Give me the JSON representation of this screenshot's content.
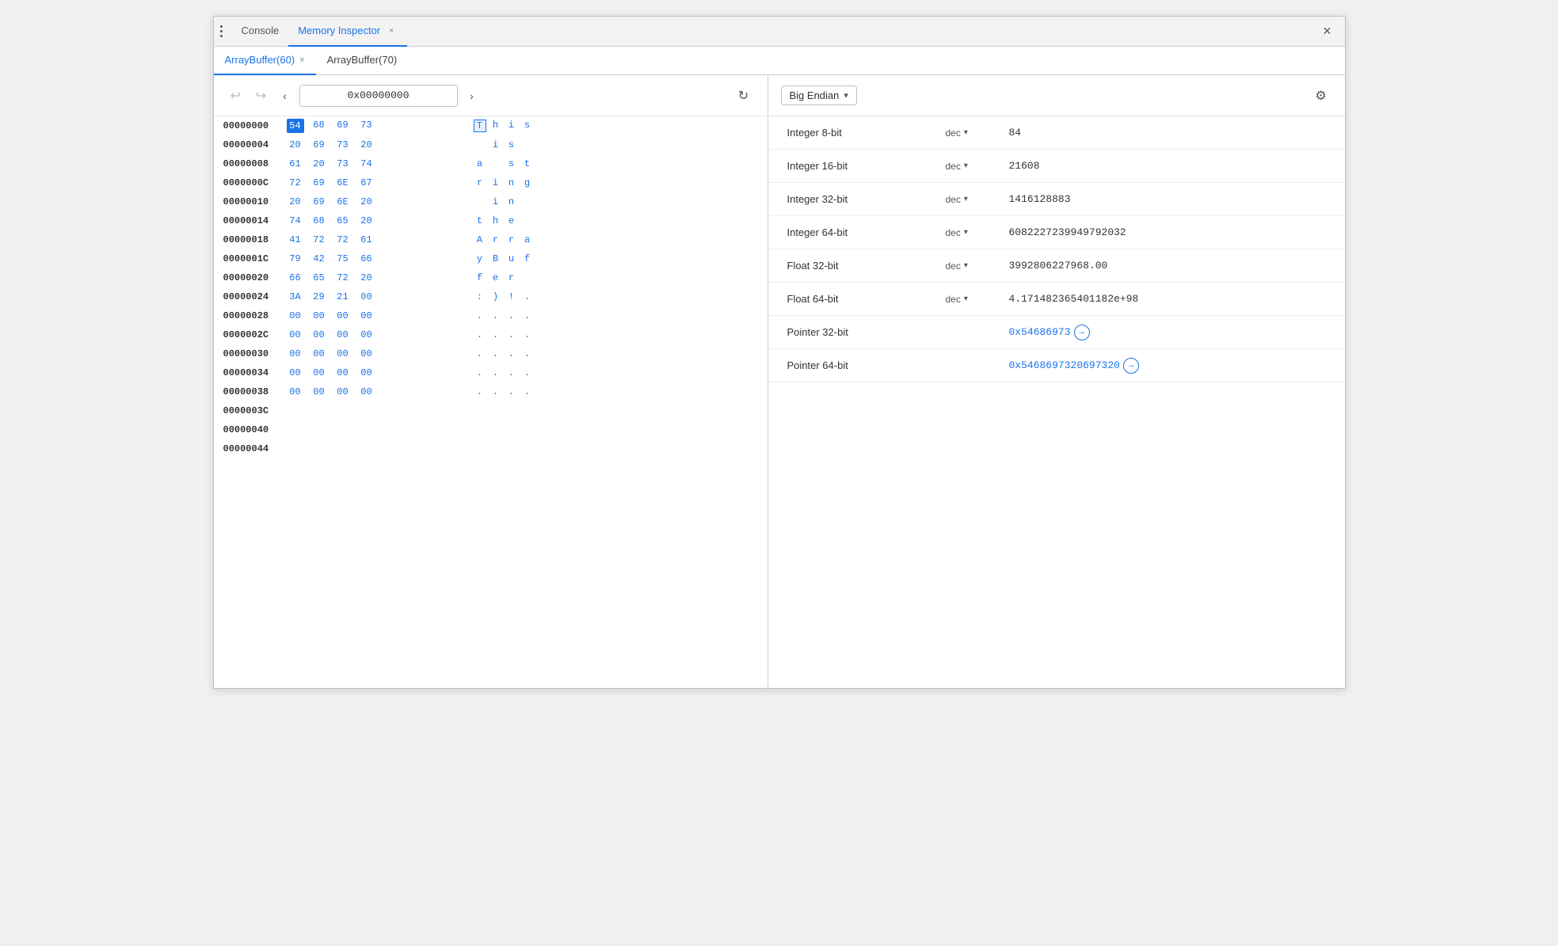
{
  "window": {
    "title": "Memory Inspector",
    "close_label": "×"
  },
  "top_tabs": [
    {
      "id": "console",
      "label": "Console",
      "active": false,
      "closable": false
    },
    {
      "id": "memory_inspector",
      "label": "Memory Inspector",
      "active": true,
      "closable": true
    }
  ],
  "buffer_tabs": [
    {
      "id": "arraybuffer60",
      "label": "ArrayBuffer(60)",
      "active": true,
      "closable": true
    },
    {
      "id": "arraybuffer70",
      "label": "ArrayBuffer(70)",
      "active": false,
      "closable": false
    }
  ],
  "nav": {
    "back_label": "←",
    "forward_label": "→",
    "prev_label": "‹",
    "next_label": "›",
    "address": "0x00000000",
    "refresh_label": "↻"
  },
  "hex_rows": [
    {
      "addr": "00000000",
      "bytes": [
        "54",
        "68",
        "69",
        "73"
      ],
      "chars": [
        "T",
        "h",
        "i",
        "s"
      ],
      "selected_byte": 0,
      "highlighted_char": 0
    },
    {
      "addr": "00000004",
      "bytes": [
        "20",
        "69",
        "73",
        "20"
      ],
      "chars": [
        " ",
        "i",
        "s",
        " "
      ]
    },
    {
      "addr": "00000008",
      "bytes": [
        "61",
        "20",
        "73",
        "74"
      ],
      "chars": [
        "a",
        " ",
        "s",
        "t"
      ]
    },
    {
      "addr": "0000000C",
      "bytes": [
        "72",
        "69",
        "6E",
        "67"
      ],
      "chars": [
        "r",
        "i",
        "n",
        "g"
      ]
    },
    {
      "addr": "00000010",
      "bytes": [
        "20",
        "69",
        "6E",
        "20"
      ],
      "chars": [
        " ",
        "i",
        "n",
        " "
      ]
    },
    {
      "addr": "00000014",
      "bytes": [
        "74",
        "68",
        "65",
        "20"
      ],
      "chars": [
        "t",
        "h",
        "e",
        " "
      ]
    },
    {
      "addr": "00000018",
      "bytes": [
        "41",
        "72",
        "72",
        "61"
      ],
      "chars": [
        "A",
        "r",
        "r",
        "a"
      ]
    },
    {
      "addr": "0000001C",
      "bytes": [
        "79",
        "42",
        "75",
        "66"
      ],
      "chars": [
        "y",
        "B",
        "u",
        "f"
      ]
    },
    {
      "addr": "00000020",
      "bytes": [
        "66",
        "65",
        "72",
        "20"
      ],
      "chars": [
        "f",
        "e",
        "r",
        " "
      ]
    },
    {
      "addr": "00000024",
      "bytes": [
        "3A",
        "29",
        "21",
        "00"
      ],
      "chars": [
        ":",
        ")",
        "!",
        "."
      ]
    },
    {
      "addr": "00000028",
      "bytes": [
        "00",
        "00",
        "00",
        "00"
      ],
      "chars": [
        ".",
        ".",
        ".",
        "."
      ]
    },
    {
      "addr": "0000002C",
      "bytes": [
        "00",
        "00",
        "00",
        "00"
      ],
      "chars": [
        ".",
        ".",
        ".",
        "."
      ]
    },
    {
      "addr": "00000030",
      "bytes": [
        "00",
        "00",
        "00",
        "00"
      ],
      "chars": [
        ".",
        ".",
        ".",
        "."
      ]
    },
    {
      "addr": "00000034",
      "bytes": [
        "00",
        "00",
        "00",
        "00"
      ],
      "chars": [
        ".",
        ".",
        ".",
        "."
      ]
    },
    {
      "addr": "00000038",
      "bytes": [
        "00",
        "00",
        "00",
        "00"
      ],
      "chars": [
        ".",
        ".",
        ".",
        "."
      ]
    },
    {
      "addr": "0000003C",
      "bytes": [],
      "chars": []
    },
    {
      "addr": "00000040",
      "bytes": [],
      "chars": []
    },
    {
      "addr": "00000044",
      "bytes": [],
      "chars": []
    }
  ],
  "endian": {
    "label": "Big Endian",
    "arrow": "▾",
    "gear_label": "⚙"
  },
  "value_rows": [
    {
      "id": "int8",
      "type": "Integer 8-bit",
      "format": "dec",
      "has_dropdown": true,
      "value": "84",
      "is_link": false
    },
    {
      "id": "int16",
      "type": "Integer 16-bit",
      "format": "dec",
      "has_dropdown": true,
      "value": "21608",
      "is_link": false
    },
    {
      "id": "int32",
      "type": "Integer 32-bit",
      "format": "dec",
      "has_dropdown": true,
      "value": "1416128883",
      "is_link": false
    },
    {
      "id": "int64",
      "type": "Integer 64-bit",
      "format": "dec",
      "has_dropdown": true,
      "value": "6082227239949792032",
      "is_link": false
    },
    {
      "id": "float32",
      "type": "Float 32-bit",
      "format": "dec",
      "has_dropdown": true,
      "value": "3992806227968.00",
      "is_link": false
    },
    {
      "id": "float64",
      "type": "Float 64-bit",
      "format": "dec",
      "has_dropdown": true,
      "value": "4.17148236540 1182e+98",
      "is_link": false
    },
    {
      "id": "ptr32",
      "type": "Pointer 32-bit",
      "format": "",
      "has_dropdown": false,
      "value": "0x54686973",
      "is_link": true
    },
    {
      "id": "ptr64",
      "type": "Pointer 64-bit",
      "format": "",
      "has_dropdown": false,
      "value": "0x5468697320697320",
      "is_link": true
    }
  ],
  "colors": {
    "accent": "#1a73e8",
    "border": "#d0d0d0",
    "bg_light": "#f8f8f8",
    "text_main": "#333333"
  }
}
